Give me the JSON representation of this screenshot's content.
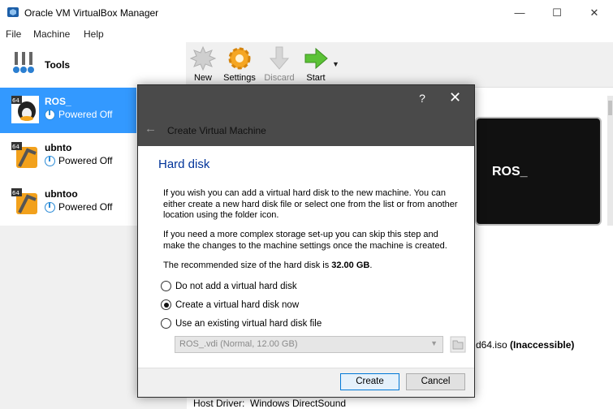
{
  "window": {
    "title": "Oracle VM VirtualBox Manager",
    "controls": {
      "minimize": "—",
      "maximize": "☐",
      "close": "✕"
    }
  },
  "menu": [
    "File",
    "Machine",
    "Help"
  ],
  "sidebar": {
    "tools_label": "Tools",
    "vms": [
      {
        "name": "ROS_",
        "state": "Powered Off",
        "selected": true
      },
      {
        "name": "ubnto",
        "state": "Powered Off",
        "selected": false
      },
      {
        "name": "ubntoo",
        "state": "Powered Off",
        "selected": false
      }
    ]
  },
  "toolbar": {
    "new": "New",
    "settings": "Settings",
    "discard": "Discard",
    "start": "Start"
  },
  "details": {
    "preview_name": "ROS_",
    "storage_partial": "d64.iso",
    "inaccessible": "(Inaccessible)",
    "host_driver_label": "Host Driver:",
    "host_driver_value": "Windows DirectSound"
  },
  "dialog": {
    "help": "?",
    "close": "✕",
    "title": "Create Virtual Machine",
    "heading": "Hard disk",
    "para1": "If you wish you can add a virtual hard disk to the new machine. You can either create a new hard disk file or select one from the list or from another location using the folder icon.",
    "para2": "If you need a more complex storage set-up you can skip this step and make the changes to the machine settings once the machine is created.",
    "para3_prefix": "The recommended size of the hard disk is ",
    "para3_size": "32.00 GB",
    "para3_suffix": ".",
    "options": [
      {
        "label": "Do not add a virtual hard disk",
        "checked": false
      },
      {
        "label": "Create a virtual hard disk now",
        "checked": true
      },
      {
        "label": "Use an existing virtual hard disk file",
        "checked": false
      }
    ],
    "combo_value": "ROS_.vdi (Normal, 12.00 GB)",
    "create_button": "Create",
    "cancel_button": "Cancel"
  }
}
